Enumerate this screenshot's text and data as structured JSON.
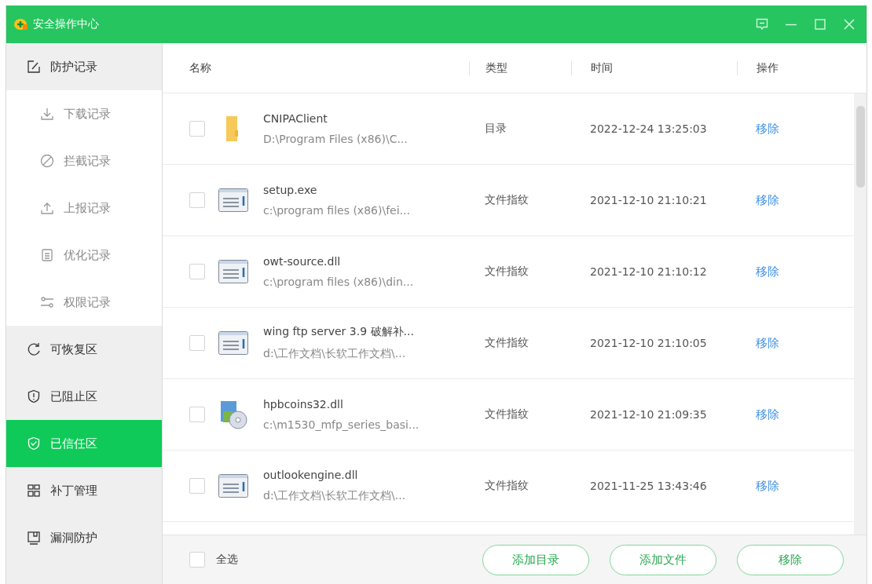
{
  "window": {
    "title": "安全操作中心"
  },
  "sidebar": {
    "items": [
      {
        "kind": "group",
        "label": "防护记录",
        "selected": false
      },
      {
        "kind": "sub",
        "label": "下载记录",
        "selected": false
      },
      {
        "kind": "sub",
        "label": "拦截记录",
        "selected": false
      },
      {
        "kind": "sub",
        "label": "上报记录",
        "selected": false
      },
      {
        "kind": "sub",
        "label": "优化记录",
        "selected": false
      },
      {
        "kind": "sub",
        "label": "权限记录",
        "selected": false
      },
      {
        "kind": "group",
        "label": "可恢复区",
        "selected": false
      },
      {
        "kind": "group",
        "label": "已阻止区",
        "selected": false
      },
      {
        "kind": "group",
        "label": "已信任区",
        "selected": true
      },
      {
        "kind": "group",
        "label": "补丁管理",
        "selected": false
      },
      {
        "kind": "group",
        "label": "漏洞防护",
        "selected": false
      }
    ]
  },
  "table": {
    "columns": [
      "名称",
      "类型",
      "时间",
      "操作"
    ],
    "rows": [
      {
        "checked": false,
        "kind": "folder",
        "name": "CNIPAClient",
        "path": "D:\\Program Files (x86)\\C...",
        "type": "目录",
        "time": "2022-12-24 13:25:03",
        "action": "移除"
      },
      {
        "checked": false,
        "kind": "program",
        "name": "setup.exe",
        "path": "c:\\program files (x86)\\fei...",
        "type": "文件指纹",
        "time": "2021-12-10 21:10:21",
        "action": "移除"
      },
      {
        "checked": false,
        "kind": "program",
        "name": "owt-source.dll",
        "path": "c:\\program files (x86)\\din...",
        "type": "文件指纹",
        "time": "2021-12-10 21:10:12",
        "action": "移除"
      },
      {
        "checked": false,
        "kind": "program",
        "name": "wing ftp server 3.9 破解补...",
        "path": "d:\\工作文档\\长软工作文档\\...",
        "type": "文件指纹",
        "time": "2021-12-10 21:10:05",
        "action": "移除"
      },
      {
        "checked": false,
        "kind": "installer",
        "name": "hpbcoins32.dll",
        "path": "c:\\m1530_mfp_series_basi...",
        "type": "文件指纹",
        "time": "2021-12-10 21:09:35",
        "action": "移除"
      },
      {
        "checked": false,
        "kind": "program",
        "name": "outlookengine.dll",
        "path": "d:\\工作文档\\长软工作文档\\...",
        "type": "文件指纹",
        "time": "2021-11-25 13:43:46",
        "action": "移除"
      }
    ]
  },
  "footer": {
    "select_all": {
      "label": "全选",
      "checked": false
    },
    "buttons": [
      "添加目录",
      "添加文件",
      "移除"
    ]
  }
}
